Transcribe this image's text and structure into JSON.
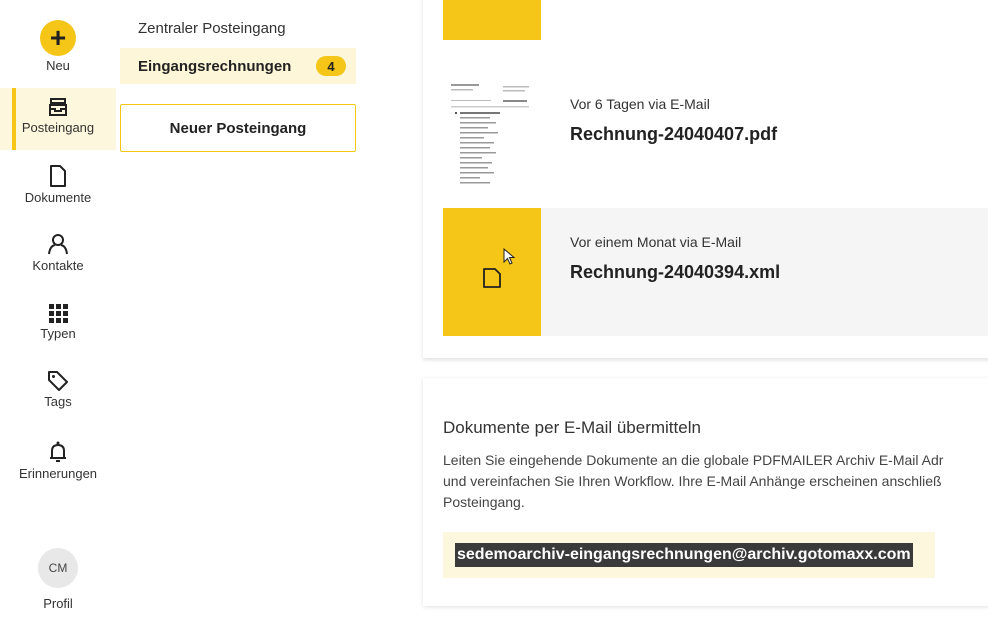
{
  "rail": {
    "items": [
      {
        "label": "Neu",
        "icon": "plus-icon"
      },
      {
        "label": "Posteingang",
        "icon": "inbox-icon",
        "active": true
      },
      {
        "label": "Dokumente",
        "icon": "document-icon"
      },
      {
        "label": "Kontakte",
        "icon": "contact-icon"
      },
      {
        "label": "Typen",
        "icon": "grid-icon"
      },
      {
        "label": "Tags",
        "icon": "tag-icon"
      },
      {
        "label": "Erinnerungen",
        "icon": "bell-icon"
      }
    ],
    "profile": {
      "initials": "CM",
      "label": "Profil"
    }
  },
  "inbox": {
    "title": "Zentraler Posteingang",
    "selected": {
      "label": "Eingangsrechnungen",
      "count": "4"
    },
    "new_inbox_label": "Neuer Posteingang"
  },
  "documents": [
    {
      "meta": "Vor 6 Tagen via E-Mail",
      "name": "Rechnung-24040407.pdf"
    },
    {
      "meta": "Vor einem Monat via E-Mail",
      "name": "Rechnung-24040394.xml"
    }
  ],
  "email_card": {
    "title": "Dokumente per E-Mail übermitteln",
    "text_lines": [
      "Leiten Sie eingehende Dokumente an die globale PDFMAILER Archiv E-Mail Adr",
      "und vereinfachen Sie Ihren Workflow. Ihre E-Mail Anhänge erscheinen anschließ",
      "Posteingang."
    ],
    "email": "sedemoarchiv-eingangsrechnungen@archiv.gotomaxx.com"
  },
  "colors": {
    "accent": "#f5c518",
    "accent_light": "#fdf7dd"
  }
}
